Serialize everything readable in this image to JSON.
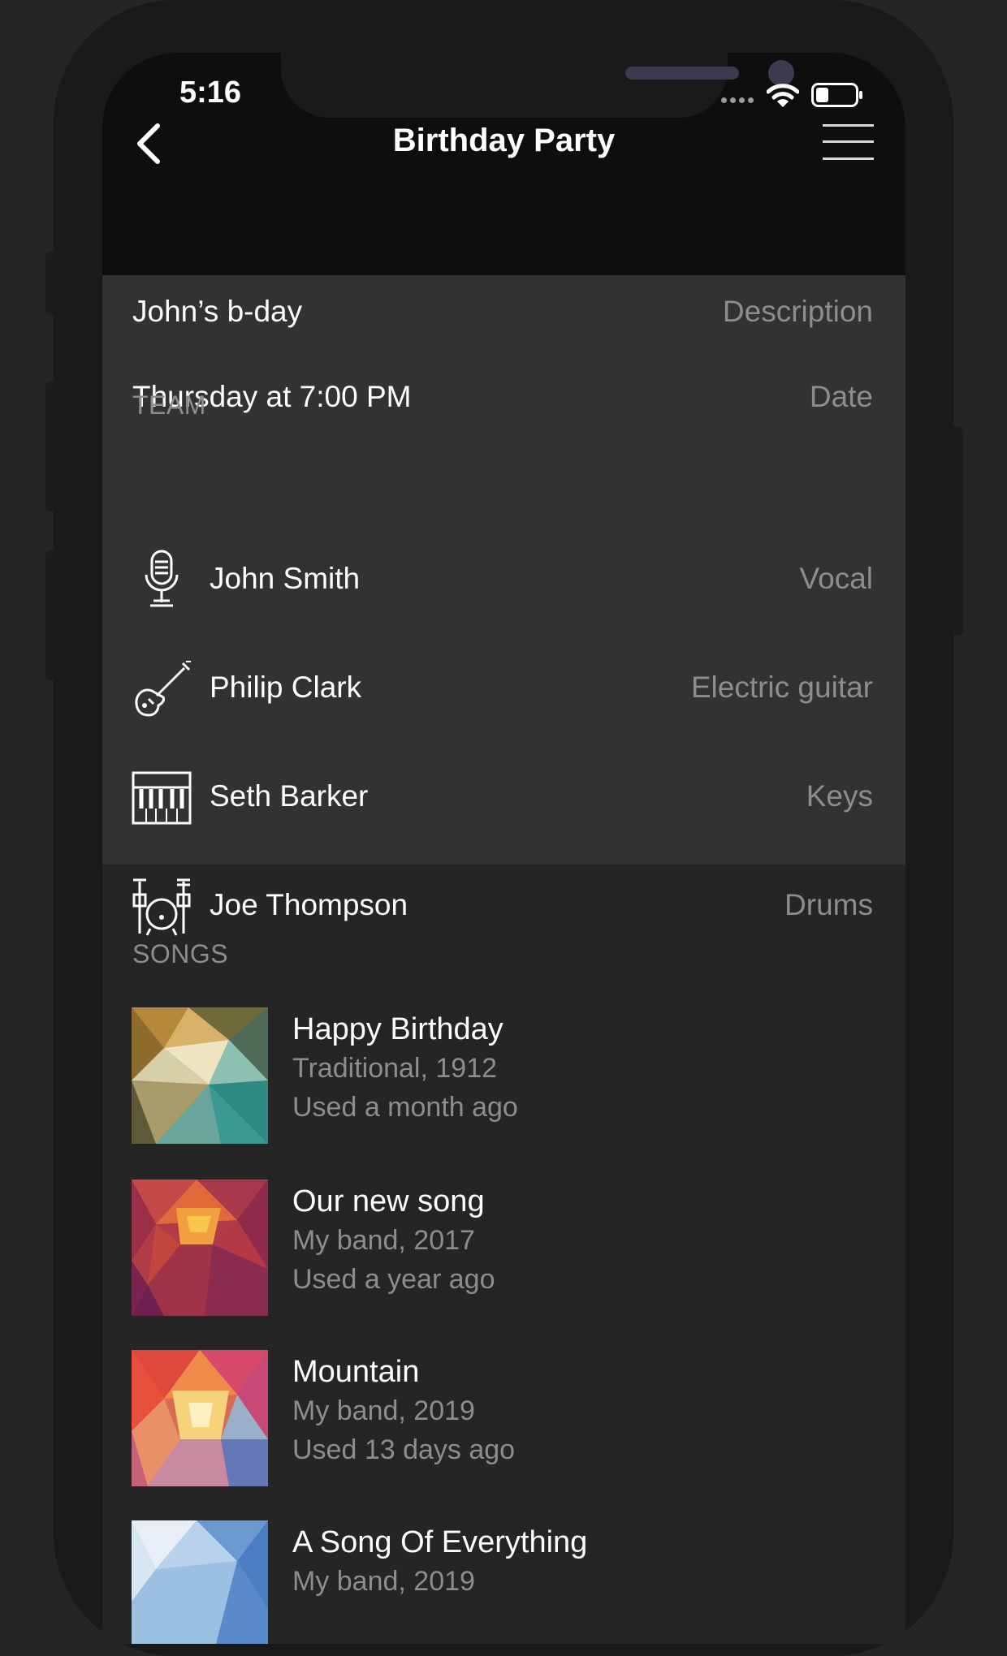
{
  "status_bar": {
    "time": "5:16"
  },
  "nav": {
    "title": "Birthday Party",
    "back_icon": "chevron-left-icon",
    "menu_icon": "hamburger-menu-icon"
  },
  "event": {
    "description_value": "John’s b-day",
    "description_label": "Description",
    "date_value": "Thursday at 7:00 PM",
    "date_label": "Date"
  },
  "team": {
    "header": "TEAM",
    "members": [
      {
        "name": "John Smith",
        "role": "Vocal",
        "icon": "microphone-icon"
      },
      {
        "name": "Philip Clark",
        "role": "Electric guitar",
        "icon": "electric-guitar-icon"
      },
      {
        "name": "Seth Barker",
        "role": "Keys",
        "icon": "piano-keys-icon"
      },
      {
        "name": "Joe Thompson",
        "role": "Drums",
        "icon": "drum-kit-icon"
      }
    ]
  },
  "songs": {
    "header": "SONGS",
    "items": [
      {
        "title": "Happy Birthday",
        "author": "Traditional, 1912",
        "used": "Used a month ago"
      },
      {
        "title": "Our new song",
        "author": "My band, 2017",
        "used": "Used a year ago"
      },
      {
        "title": "Mountain",
        "author": "My band, 2019",
        "used": "Used 13 days ago"
      },
      {
        "title": "A Song Of Everything",
        "author": "My band, 2019",
        "used": ""
      }
    ]
  },
  "colors": {
    "background": "#252526",
    "row_background": "#323233",
    "nav_background": "#0e0e0e",
    "primary_text": "#ffffff",
    "secondary_text": "#8d8d8d"
  }
}
